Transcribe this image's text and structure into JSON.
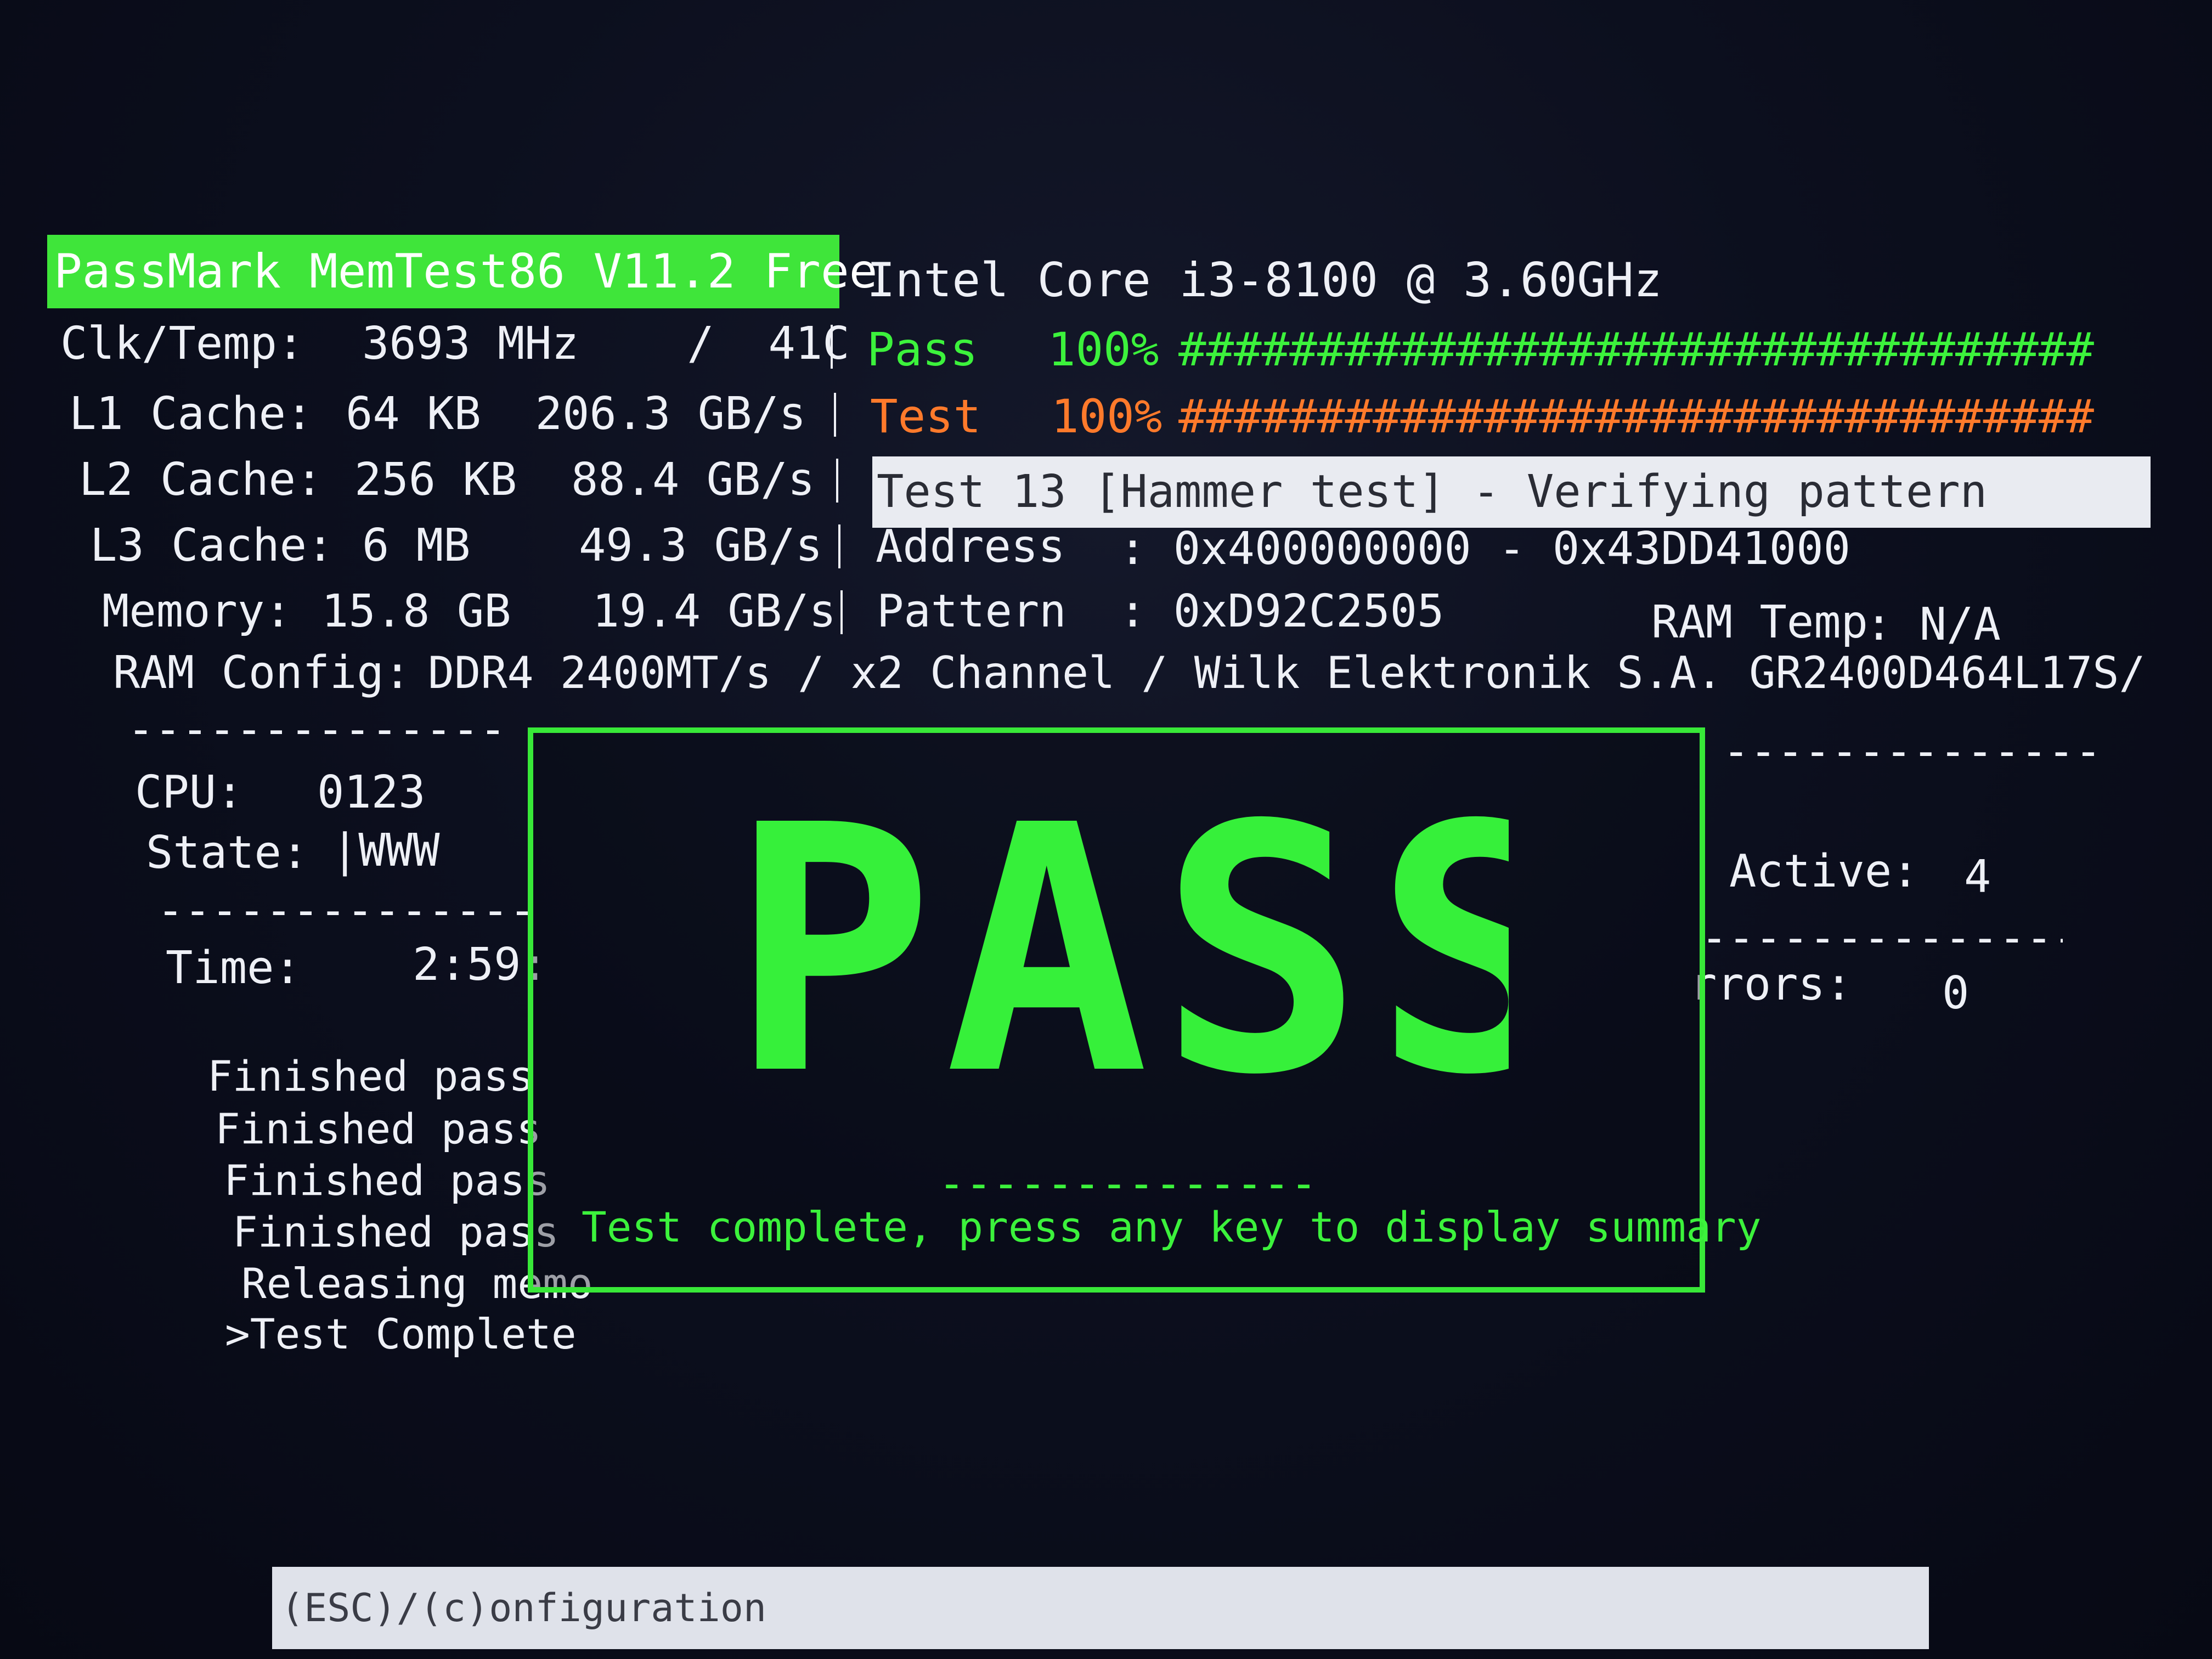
{
  "header": {
    "app_title": "PassMark MemTest86 V11.2 Free",
    "cpu_name": "Intel Core i3-8100 @ 3.60GHz"
  },
  "system": {
    "clk_temp": {
      "label": "Clk/Temp:",
      "value": "3693 MHz    /  41C"
    },
    "l1": {
      "label": "L1 Cache:",
      "value": "64 KB  206.3 GB/s"
    },
    "l2": {
      "label": "L2 Cache:",
      "value": "256 KB  88.4 GB/s"
    },
    "l3": {
      "label": "L3 Cache:",
      "value": "6 MB    49.3 GB/s"
    },
    "memory": {
      "label": "Memory:",
      "value": "15.8 GB   19.4 GB/s"
    },
    "ram_config": {
      "label": "RAM Config:",
      "value": "DDR4 2400MT/s / x2 Channel / Wilk Elektronik S.A. GR2400D464L17S/"
    }
  },
  "progress": {
    "pass": {
      "label": "Pass",
      "percent_text": "100%",
      "bar": "#################################",
      "value": 1.0,
      "color": "#3cf23c"
    },
    "test": {
      "label": "Test",
      "percent_text": "100%",
      "bar": "#################################",
      "value": 1.0,
      "color": "#ff7a2b"
    }
  },
  "test_status": "Test 13 [Hammer test] - Verifying pattern",
  "address": {
    "label": "Address",
    "value": ": 0x400000000 - 0x43DD41000"
  },
  "pattern": {
    "label": "Pattern",
    "value": ": 0xD92C2505"
  },
  "ram_temp": {
    "label": "RAM Temp",
    "value": ": N/A"
  },
  "left_panel": {
    "cpu": {
      "label": "CPU:",
      "value": "0123"
    },
    "state": {
      "label": "State:",
      "value": "|WWW"
    },
    "time": {
      "label": "Time:",
      "value": "2:59:"
    },
    "log": [
      "Finished pass",
      "Finished pass",
      "Finished pass",
      "Finished pass",
      "Releasing memo",
      ">Test Complete"
    ]
  },
  "right_panel": {
    "active": {
      "label": "Active:",
      "value": "4"
    },
    "errors": {
      "label": "rrors:",
      "value": "0"
    }
  },
  "result": {
    "word": "PASS",
    "separator": "--------------",
    "message": "Test complete, press any key to display summary"
  },
  "footer": {
    "hint": "(ESC)/(c)onfiguration"
  },
  "colors": {
    "accent_green": "#3cf23c",
    "accent_orange": "#ff7a2b",
    "title_bg": "#3fe53a"
  }
}
